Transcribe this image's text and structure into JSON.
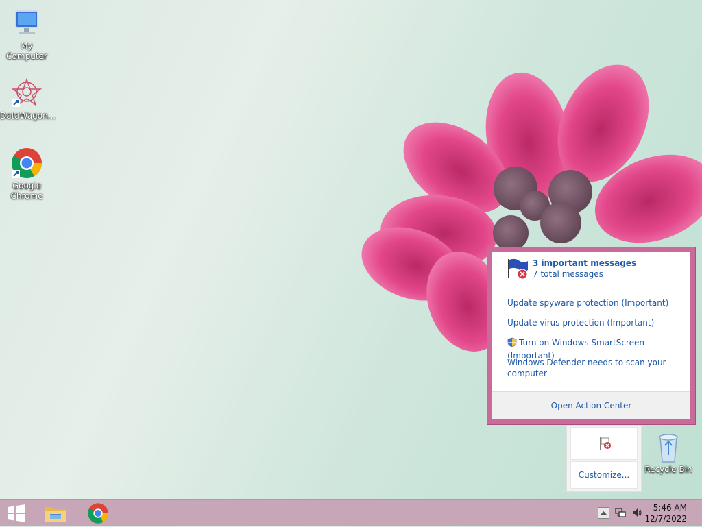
{
  "desktop": {
    "icons": [
      {
        "label": "My Computer",
        "icon": "computer-icon"
      },
      {
        "label": "DataWagon...",
        "icon": "datawagon-icon"
      },
      {
        "label": "Google Chrome",
        "icon": "chrome-icon"
      },
      {
        "label": "Recycle Bin",
        "icon": "recycle-bin-icon"
      }
    ]
  },
  "action_center_popup": {
    "title": "3 important messages",
    "subtitle": "7 total messages",
    "messages": [
      {
        "text": "Update spyware protection (Important)"
      },
      {
        "text": "Update virus protection (Important)"
      },
      {
        "text": "Turn on Windows SmartScreen (Important)",
        "icon": "uac-shield-icon"
      },
      {
        "text": "Windows Defender needs to scan your computer"
      }
    ],
    "footer_link": "Open Action Center"
  },
  "tray_overflow": {
    "icon": "action-center-flag-icon",
    "customize_label": "Customize..."
  },
  "taskbar": {
    "start_icon": "windows-logo-icon",
    "pinned": [
      "file-explorer-icon",
      "chrome-icon"
    ],
    "tray_icons": [
      "show-hidden-icons-icon",
      "network-icon",
      "volume-icon"
    ],
    "time": "5:46 AM",
    "date": "12/7/2022"
  },
  "colors": {
    "link": "#1e5aa8",
    "popup_border": "#c86b9a",
    "taskbar": "#c7a6b8"
  }
}
